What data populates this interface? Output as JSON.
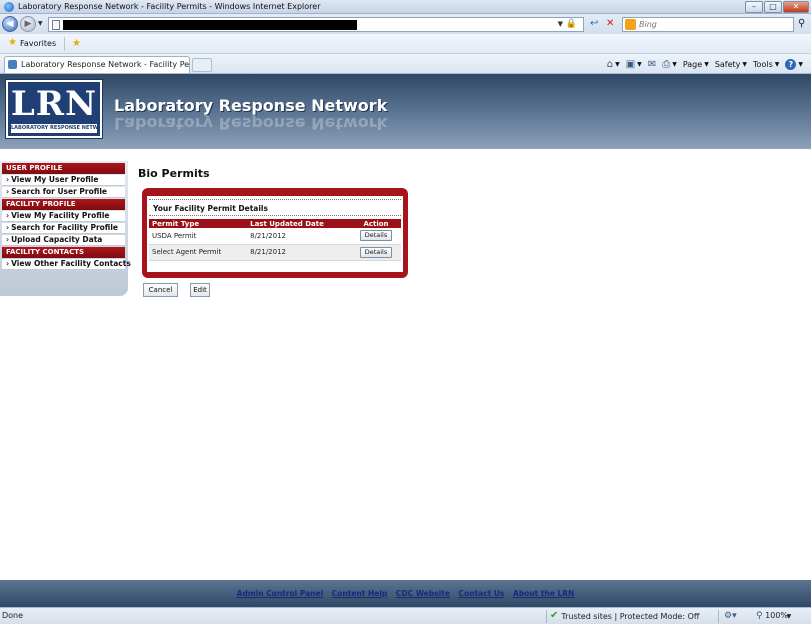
{
  "window": {
    "title": "Laboratory Response Network - Facility Permits - Windows Internet Explorer",
    "buttons": {
      "minimize": "–",
      "maximize": "□",
      "close": "✕"
    }
  },
  "address_bar": {
    "search_placeholder": "Bing"
  },
  "favorites_bar": {
    "favorites_label": "Favorites"
  },
  "tab": {
    "label": "Laboratory Response Network - Facility Permits"
  },
  "command_bar": {
    "page_label": "Page",
    "safety_label": "Safety",
    "tools_label": "Tools"
  },
  "site_header": {
    "logo_letters": "LRN",
    "logo_tagline": "LABORATORY RESPONSE NETWORK",
    "title": "Laboratory Response Network"
  },
  "sidebar": {
    "sections": [
      {
        "heading": "USER PROFILE",
        "items": [
          "View My User Profile",
          "Search for User Profile"
        ]
      },
      {
        "heading": "FACILITY PROFILE",
        "items": [
          "View My Facility Profile",
          "Search for Facility Profile",
          "Upload Capacity Data"
        ]
      },
      {
        "heading": "FACILITY CONTACTS",
        "items": [
          "View Other Facility Contacts"
        ]
      }
    ]
  },
  "main": {
    "page_title": "Bio Permits",
    "panel_title": "Your Facility Permit Details",
    "table": {
      "headers": [
        "Permit Type",
        "Last Updated Date",
        "Action"
      ],
      "rows": [
        {
          "permit_type": "USDA Permit",
          "last_updated": "8/21/2012",
          "action": "Details"
        },
        {
          "permit_type": "Select Agent Permit",
          "last_updated": "8/21/2012",
          "action": "Details"
        }
      ]
    },
    "cancel_label": "Cancel",
    "edit_label": "Edit"
  },
  "footer": {
    "links": [
      "Admin Control Panel",
      "Content Help",
      "CDC Website",
      "Contact Us",
      "About the LRN"
    ]
  },
  "status_bar": {
    "status_text": "Done",
    "zone_text": "Trusted sites | Protected Mode: Off",
    "zoom_text": "100%"
  },
  "colors": {
    "brand_red": "#a8141c",
    "header_blue": "#2e4866",
    "link_blue": "#1a2a7a"
  }
}
